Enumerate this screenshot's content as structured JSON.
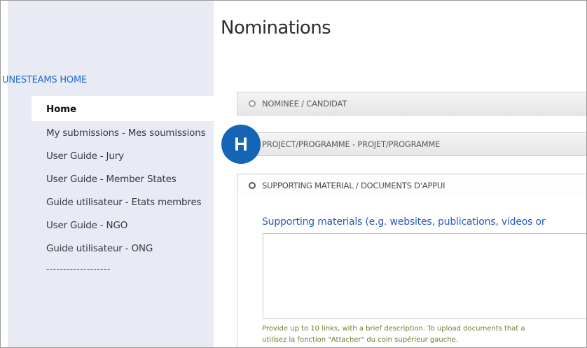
{
  "sidebar": {
    "site_home": "UNESTEAMS HOME",
    "items": [
      {
        "label": "Home",
        "active": true
      },
      {
        "label": "My submissions - Mes soumissions"
      },
      {
        "label": "User Guide - Jury"
      },
      {
        "label": "User Guide - Member States"
      },
      {
        "label": "Guide utilisateur - Etats membres"
      },
      {
        "label": "User Guide - NGO"
      },
      {
        "label": "Guide utilisateur - ONG"
      }
    ],
    "separator": "-------------------"
  },
  "main": {
    "title": "Nominations",
    "sections": [
      {
        "label": "NOMINEE / CANDIDAT",
        "icon": "radio-unselected-icon"
      },
      {
        "label": "PROJECT/PROGRAMME - PROJET/PROGRAMME",
        "icon": "radio-unselected-icon"
      },
      {
        "label": "SUPPORTING MATERIAL / DOCUMENTS D'APPUI",
        "icon": "radio-selected-icon",
        "expanded": true
      }
    ],
    "field_label": "Supporting materials (e.g. websites, publications, videos or",
    "field_value": "",
    "help_line1": "Provide up to 10 links, with a brief description. To upload documents that a",
    "help_line2": "utilisez la fonction \"Attacher\" du coin supérieur gauche."
  },
  "badge": {
    "letter": "H",
    "color": "#1565b6"
  }
}
